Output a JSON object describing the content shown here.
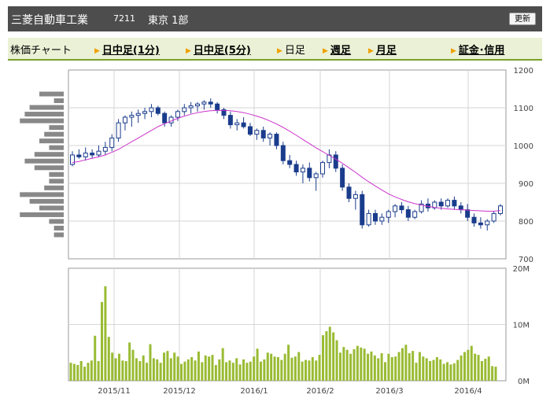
{
  "header": {
    "company": "三菱自動車工業",
    "code": "7211",
    "market": "東京 1部",
    "refresh_label": "更新"
  },
  "tabs": {
    "static_label": "株価チャート",
    "items": [
      {
        "label": "日中足(1分)",
        "link": true,
        "arrow": true
      },
      {
        "label": "日中足(5分)",
        "link": true,
        "arrow": true
      },
      {
        "label": "日足",
        "link": false,
        "arrow": true
      },
      {
        "label": "週足",
        "link": true,
        "arrow": true
      },
      {
        "label": "月足",
        "link": true,
        "arrow": true
      },
      {
        "label": "証金･信用",
        "link": true,
        "arrow": true
      }
    ]
  },
  "colors": {
    "header_bg": "#4d4d4d",
    "tab_bg": "#eaf1d6",
    "tab_border": "#7aa02a",
    "candle": "#1a3c8c",
    "moving_average": "#cc33cc",
    "volume_bar": "#99bb33",
    "volume_profile": "#888888",
    "grid": "#d6d6d6",
    "arrow": "#f0a000"
  },
  "chart_data": {
    "type": "candlestick",
    "price_axis": {
      "ticks": [
        "1200",
        "1100",
        "1000",
        "900",
        "800",
        "700"
      ],
      "ylim": [
        700,
        1200
      ],
      "side": "right"
    },
    "volume_axis": {
      "ticks": [
        "20M",
        "10M",
        "0M"
      ],
      "ylim": [
        0,
        20
      ],
      "unit": "M"
    },
    "date_labels": [
      "2015/11",
      "2015/12",
      "2016/1",
      "2016/2",
      "2016/3",
      "2016/4"
    ],
    "ohlc": [
      [
        950,
        985,
        945,
        975
      ],
      [
        975,
        990,
        965,
        970
      ],
      [
        970,
        995,
        960,
        980
      ],
      [
        980,
        990,
        965,
        975
      ],
      [
        975,
        1000,
        970,
        985
      ],
      [
        985,
        1010,
        975,
        995
      ],
      [
        995,
        1030,
        985,
        1020
      ],
      [
        1020,
        1070,
        1010,
        1060
      ],
      [
        1060,
        1080,
        1040,
        1075
      ],
      [
        1075,
        1090,
        1050,
        1080
      ],
      [
        1080,
        1095,
        1060,
        1085
      ],
      [
        1085,
        1100,
        1070,
        1090
      ],
      [
        1090,
        1110,
        1075,
        1100
      ],
      [
        1100,
        1105,
        1080,
        1085
      ],
      [
        1085,
        1090,
        1050,
        1060
      ],
      [
        1060,
        1080,
        1050,
        1075
      ],
      [
        1075,
        1095,
        1065,
        1090
      ],
      [
        1090,
        1110,
        1080,
        1100
      ],
      [
        1100,
        1115,
        1085,
        1105
      ],
      [
        1105,
        1115,
        1090,
        1110
      ],
      [
        1110,
        1120,
        1095,
        1115
      ],
      [
        1115,
        1125,
        1100,
        1110
      ],
      [
        1110,
        1115,
        1085,
        1095
      ],
      [
        1095,
        1100,
        1070,
        1080
      ],
      [
        1080,
        1090,
        1045,
        1055
      ],
      [
        1055,
        1070,
        1040,
        1060
      ],
      [
        1060,
        1075,
        1045,
        1050
      ],
      [
        1050,
        1060,
        1025,
        1030
      ],
      [
        1030,
        1045,
        1015,
        1040
      ],
      [
        1040,
        1050,
        1010,
        1020
      ],
      [
        1020,
        1035,
        1000,
        1030
      ],
      [
        1030,
        1035,
        990,
        1000
      ],
      [
        1000,
        1010,
        950,
        960
      ],
      [
        960,
        975,
        940,
        950
      ],
      [
        950,
        960,
        920,
        930
      ],
      [
        930,
        950,
        900,
        940
      ],
      [
        940,
        955,
        905,
        915
      ],
      [
        915,
        930,
        880,
        925
      ],
      [
        925,
        960,
        915,
        955
      ],
      [
        955,
        990,
        940,
        975
      ],
      [
        975,
        985,
        930,
        940
      ],
      [
        940,
        950,
        880,
        890
      ],
      [
        890,
        900,
        850,
        860
      ],
      [
        860,
        880,
        830,
        870
      ],
      [
        870,
        880,
        780,
        790
      ],
      [
        790,
        830,
        785,
        820
      ],
      [
        820,
        830,
        790,
        800
      ],
      [
        800,
        820,
        790,
        810
      ],
      [
        810,
        830,
        795,
        825
      ],
      [
        825,
        845,
        810,
        840
      ],
      [
        840,
        850,
        820,
        830
      ],
      [
        830,
        840,
        800,
        810
      ],
      [
        810,
        830,
        805,
        825
      ],
      [
        825,
        855,
        820,
        845
      ],
      [
        845,
        860,
        825,
        835
      ],
      [
        835,
        855,
        830,
        850
      ],
      [
        850,
        860,
        830,
        840
      ],
      [
        840,
        860,
        835,
        855
      ],
      [
        855,
        865,
        830,
        840
      ],
      [
        840,
        850,
        820,
        830
      ],
      [
        830,
        845,
        800,
        810
      ],
      [
        810,
        820,
        785,
        795
      ],
      [
        795,
        810,
        780,
        790
      ],
      [
        790,
        805,
        775,
        800
      ],
      [
        800,
        825,
        795,
        820
      ],
      [
        820,
        845,
        815,
        840
      ]
    ],
    "moving_average": [
      955,
      958,
      962,
      966,
      970,
      975,
      982,
      990,
      1000,
      1010,
      1020,
      1030,
      1040,
      1050,
      1058,
      1065,
      1072,
      1078,
      1083,
      1087,
      1090,
      1092,
      1093,
      1093,
      1092,
      1090,
      1087,
      1083,
      1078,
      1072,
      1065,
      1057,
      1048,
      1038,
      1027,
      1016,
      1005,
      994,
      984,
      974,
      964,
      953,
      941,
      929,
      916,
      904,
      893,
      882,
      872,
      864,
      857,
      851,
      846,
      842,
      839,
      836,
      834,
      832,
      831,
      830,
      829,
      828,
      827,
      826,
      826,
      828
    ],
    "volume_millions": [
      3.2,
      3,
      2.8,
      3.5,
      2.5,
      3.2,
      3.6,
      8,
      3.5,
      14,
      16.8,
      7.8,
      5,
      4,
      4.8,
      3.6,
      3.5,
      6.8,
      5.5,
      4,
      3.5,
      4.5,
      3.2,
      6.5,
      4,
      3.8,
      3.2,
      5,
      5.3,
      4,
      5,
      4.3,
      3,
      3.4,
      3.8,
      4.2,
      3.6,
      5.2,
      3.3,
      4.5,
      4.3,
      4.6,
      2.8,
      3.8,
      5.8,
      3.3,
      3.6,
      3.2,
      4,
      2.9,
      3.8,
      3.2,
      3.4,
      4.3,
      5.7,
      3.4,
      3.8,
      5,
      4.8,
      4.3,
      4.2,
      3.7,
      4.8,
      6.4,
      4.1,
      4.3,
      5.1,
      3.4,
      3.7,
      3.6,
      4.2,
      3.6,
      4.6,
      8.1,
      8.8,
      9.6,
      8.6,
      7.2,
      5,
      6,
      5.5,
      4.8,
      5.6,
      6.2,
      5.9,
      5.7,
      4.8,
      5.2,
      4.5,
      4,
      4.9,
      3.3,
      4.8,
      4.2,
      4.3,
      5.1,
      5.8,
      6.4,
      4.9,
      5.3,
      3.2,
      5.1,
      4.3,
      4,
      3.5,
      3.7,
      4.2,
      3.8,
      3,
      3.3,
      2.9,
      3.1,
      3.7,
      4.5,
      5.1,
      5.5,
      6.2,
      4.8,
      4.6,
      3.5,
      3.9,
      4.3,
      2.6,
      2.5
    ],
    "volume_profile": [
      0.5,
      0.2,
      0.7,
      0.8,
      0.9,
      0.3,
      0.4,
      0.5,
      0.3,
      0.6,
      0.8,
      0.6,
      0.3,
      0.3,
      0.4,
      0.9,
      0.7,
      0.5,
      0.9,
      0.3,
      0.2,
      0.2
    ]
  }
}
